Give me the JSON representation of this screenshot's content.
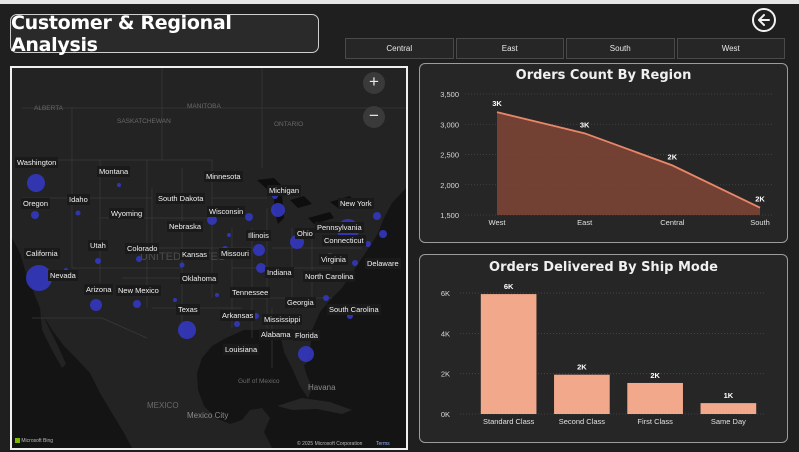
{
  "header": {
    "title": "Customer & Regional Analysis",
    "back_icon": "back-arrow-icon"
  },
  "slicer": {
    "items": [
      "Central",
      "East",
      "South",
      "West"
    ]
  },
  "map": {
    "zoom_in": "+",
    "zoom_out": "−",
    "attribution_left": "Microsoft Bing",
    "attribution_right": "© 2025 Microsoft Corporation",
    "attribution_terms": "Terms",
    "background_text": {
      "country": "UNITED STATES",
      "sea": "Gulf of Mexico",
      "mexico": "MEXICO",
      "havana": "Havana",
      "mexico_city": "Mexico City",
      "saskatchewan": "SASKATCHEWAN",
      "manitoba": "MANITOBA",
      "alberta": "ALBERTA",
      "ontario": "ONTARIO"
    },
    "states": [
      "Washington",
      "Montana",
      "Minnesota",
      "Oregon",
      "Idaho",
      "South Dakota",
      "Michigan",
      "Wyoming",
      "Wisconsin",
      "New York",
      "Nebraska",
      "Illinois",
      "Ohio",
      "Pennsylvania",
      "Connecticut",
      "Utah",
      "Colorado",
      "California",
      "Kansas",
      "Missouri",
      "Virginia",
      "Delaware",
      "Nevada",
      "Indiana",
      "Oklahoma",
      "North Carolina",
      "Arizona",
      "New Mexico",
      "Tennessee",
      "Georgia",
      "Texas",
      "Arkansas",
      "Mississippi",
      "South Carolina",
      "Alabama",
      "Florida",
      "Louisiana"
    ],
    "bubble_color": "#3538c9"
  },
  "chart_data": [
    {
      "type": "area",
      "title": "Orders Count By Region",
      "categories": [
        "West",
        "East",
        "Central",
        "South"
      ],
      "values": [
        3200,
        2850,
        2320,
        1620
      ],
      "data_labels": [
        "3K",
        "3K",
        "2K",
        "2K"
      ],
      "ylim": [
        1500,
        3500
      ],
      "yticks": [
        1500,
        2000,
        2500,
        3000,
        3500
      ],
      "ytick_labels": [
        "1,500",
        "2,000",
        "2,500",
        "3,000",
        "3,500"
      ],
      "grid": true,
      "color": "#e8876a"
    },
    {
      "type": "bar",
      "title": "Orders Delivered By Ship Mode",
      "categories": [
        "Standard Class",
        "Second Class",
        "First Class",
        "Same Day"
      ],
      "values": [
        5950,
        1950,
        1540,
        540
      ],
      "data_labels": [
        "6K",
        "2K",
        "2K",
        "1K"
      ],
      "ylim": [
        0,
        6500
      ],
      "yticks": [
        0,
        2000,
        4000,
        6000
      ],
      "ytick_labels": [
        "0K",
        "2K",
        "4K",
        "6K"
      ],
      "grid": true,
      "color": "#f2a88b"
    }
  ]
}
